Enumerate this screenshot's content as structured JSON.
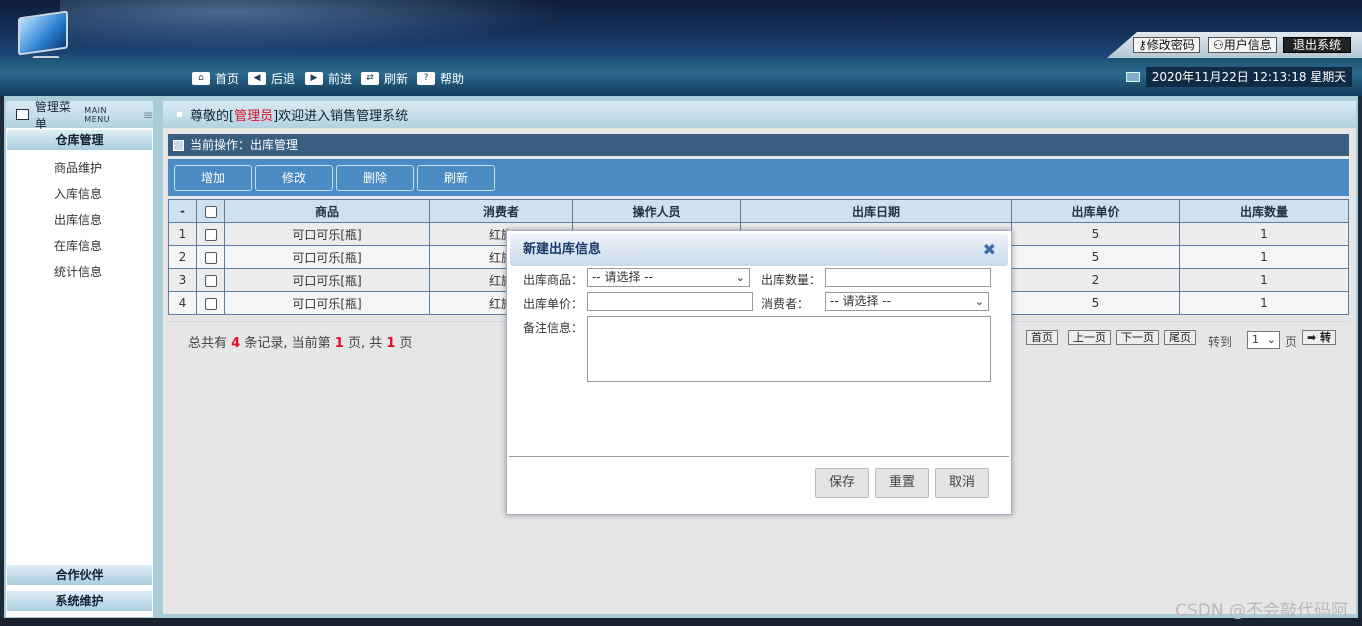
{
  "header": {
    "change_password": "修改密码",
    "user_info": "用户信息",
    "logout": "退出系统",
    "key_icon": "key-icon",
    "user_icon": "user-icon"
  },
  "nav": {
    "home": "首页",
    "back": "后退",
    "forward": "前进",
    "refresh": "刷新",
    "help": "帮助",
    "help_icon_text": "?",
    "datetime": "2020年11月22日 12:13:18 星期天"
  },
  "sidebar": {
    "title": "管理菜单",
    "title_en": "MAIN MENU",
    "section_warehouse": "仓库管理",
    "items": [
      "商品维护",
      "入库信息",
      "出库信息",
      "在库信息",
      "统计信息"
    ],
    "section_partner": "合作伙伴",
    "section_system": "系统维护"
  },
  "welcome": {
    "prefix": "尊敬的[",
    "role": "管理员",
    "suffix": "]欢迎进入销售管理系统"
  },
  "page": {
    "current_op": "当前操作：出库管理",
    "toolbar": [
      "增加",
      "修改",
      "删除",
      "刷新"
    ]
  },
  "table": {
    "headers": [
      "-",
      "",
      "商品",
      "消费者",
      "操作人员",
      "出库日期",
      "出库单价",
      "出库数量"
    ],
    "rows": [
      {
        "no": "1",
        "product": "可口可乐[瓶]",
        "consumer": "红旗",
        "operator": "",
        "date": "",
        "price": "5",
        "qty": "1"
      },
      {
        "no": "2",
        "product": "可口可乐[瓶]",
        "consumer": "红旗",
        "operator": "",
        "date": "",
        "price": "5",
        "qty": "1"
      },
      {
        "no": "3",
        "product": "可口可乐[瓶]",
        "consumer": "红旗",
        "operator": "",
        "date": "",
        "price": "2",
        "qty": "1"
      },
      {
        "no": "4",
        "product": "可口可乐[瓶]",
        "consumer": "红旗",
        "operator": "",
        "date": "",
        "price": "5",
        "qty": "1"
      }
    ]
  },
  "pager": {
    "t1": "总共有",
    "total": "4",
    "t2": "条记录, 当前第",
    "current": "1",
    "t3": "页, 共",
    "pages": "1",
    "t4": "页",
    "first": "首页",
    "prev": "上一页",
    "next": "下一页",
    "last": "尾页",
    "goto": "转到",
    "page_select": "1",
    "page_unit": "页",
    "go": "➡ 转"
  },
  "dialog": {
    "title": "新建出库信息",
    "close": "✖",
    "product_label": "出库商品：",
    "product_value": "-- 请选择 --",
    "qty_label": "出库数量：",
    "price_label": "出库单价：",
    "consumer_label": "消费者：",
    "consumer_value": "-- 请选择 --",
    "remark_label": "备注信息：",
    "save": "保存",
    "reset": "重置",
    "cancel": "取消"
  },
  "watermark": "CSDN @不会敲代码阿"
}
